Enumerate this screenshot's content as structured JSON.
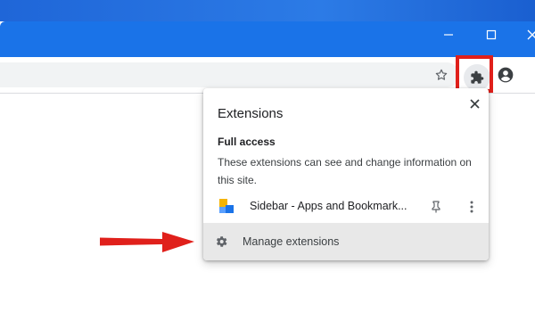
{
  "colors": {
    "titlebar": "#1a73e8",
    "highlight": "#e0201b",
    "arrow": "#e0201b",
    "manage_row_bg": "#e8e8e8"
  },
  "window_controls": [
    "minimize-icon",
    "maximize-icon",
    "close-icon"
  ],
  "toolbar": {
    "icons": [
      "bookmark-star-icon",
      "extensions-puzzle-icon",
      "profile-icon",
      "menu-kebab-icon"
    ]
  },
  "extensions_popup": {
    "title": "Extensions",
    "section_title": "Full access",
    "section_description": "These extensions can see and change information on this site.",
    "extension_name": "Sidebar - Apps and Bookmark...",
    "manage_label": "Manage extensions"
  }
}
